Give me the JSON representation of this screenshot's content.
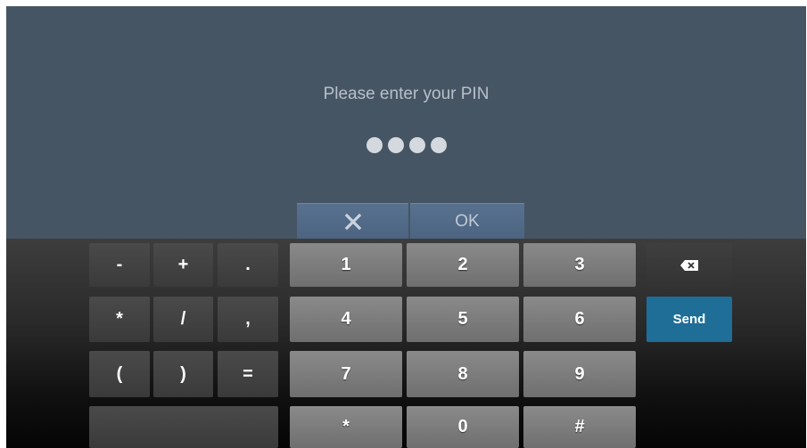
{
  "pin_dialog": {
    "prompt": "Please enter your PIN",
    "entered_digit_count": 4,
    "cancel_icon": "close-icon",
    "ok_label": "OK"
  },
  "keyboard": {
    "sym_row1": [
      "-",
      "+",
      "."
    ],
    "sym_row2": [
      "*",
      "/",
      ","
    ],
    "sym_row3": [
      "(",
      ")",
      "="
    ],
    "digits_row1": [
      "1",
      "2",
      "3"
    ],
    "digits_row2": [
      "4",
      "5",
      "6"
    ],
    "digits_row3": [
      "7",
      "8",
      "9"
    ],
    "digits_row4": [
      "*",
      "0",
      "#"
    ],
    "backspace_icon": "backspace-icon",
    "send_label": "Send"
  },
  "colors": {
    "background": "#465564",
    "action_bar": "#4c6480",
    "send_key": "#1e6e98",
    "number_key": "#7a7a7a"
  }
}
